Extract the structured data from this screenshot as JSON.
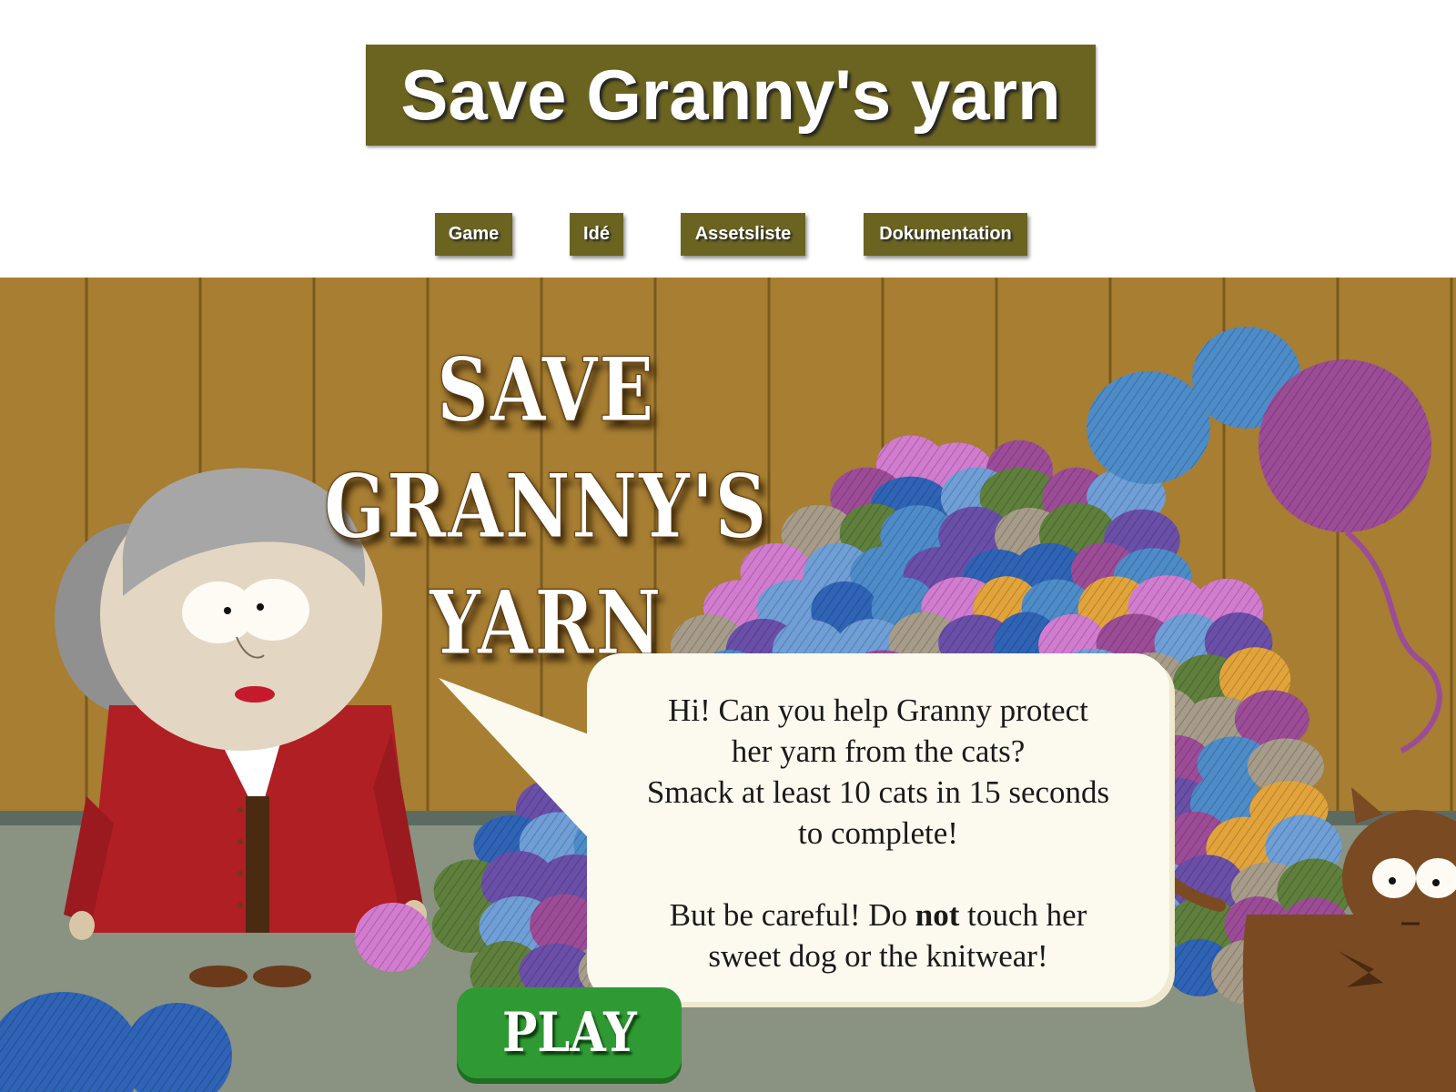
{
  "site": {
    "title": "Save Granny's yarn",
    "nav": [
      {
        "label": "Game"
      },
      {
        "label": "Idé"
      },
      {
        "label": "Assetsliste"
      },
      {
        "label": "Dokumentation"
      }
    ]
  },
  "game": {
    "title_line1": "SAVE GRANNY'S",
    "title_line2": "YARN",
    "speech": {
      "line1": "Hi! Can you help Granny protect",
      "line2": "her yarn from the cats?",
      "line3": "Smack at least 10 cats in 15 seconds",
      "line4": "to complete!",
      "line5_pre": "But be careful! Do ",
      "line5_bold": "not",
      "line5_post": " touch her",
      "line6": "sweet dog or the knitwear!"
    },
    "play_label": "PLAY"
  },
  "colors": {
    "accent": "#6b6420",
    "wall": "#a77e32",
    "floor": "#8a9282",
    "play": "#2f9a33",
    "yarn": [
      "#4d8cc8",
      "#2f63b5",
      "#9c4c97",
      "#6f9fd6",
      "#d27cd0",
      "#e2a43a",
      "#5f7f3c",
      "#a69c89",
      "#6a4fa8"
    ]
  },
  "icons": [
    "granny-character",
    "yarn-ball-icon",
    "cat-character"
  ]
}
